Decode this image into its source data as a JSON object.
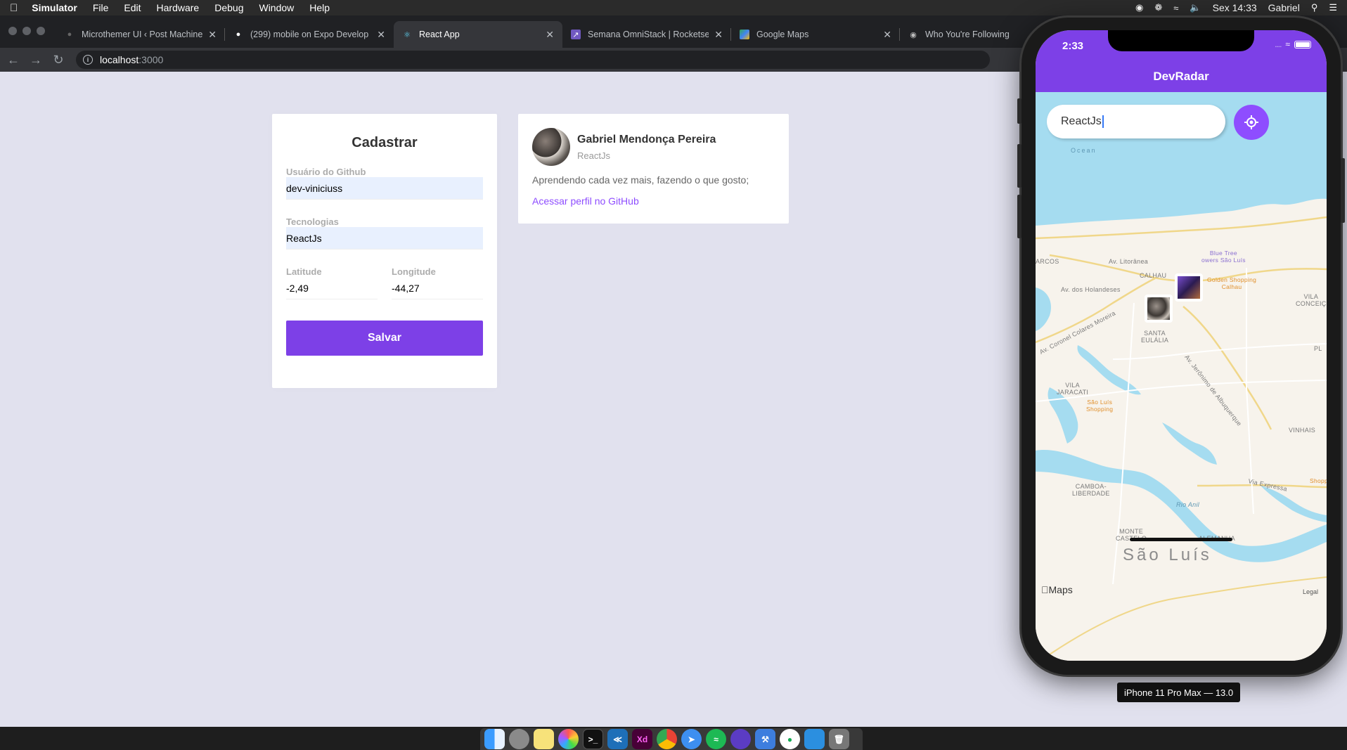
{
  "menubar": {
    "app": "Simulator",
    "items": [
      "File",
      "Edit",
      "Hardware",
      "Debug",
      "Window",
      "Help"
    ],
    "clock": "Sex 14:33",
    "user": "Gabriel"
  },
  "browser": {
    "tabs": [
      {
        "title": "Microthemer UI ‹ Post Machine",
        "icon": "wordpress-icon"
      },
      {
        "title": "(299) mobile on Expo Develop",
        "icon": "expo-icon"
      },
      {
        "title": "React App",
        "icon": "react-icon"
      },
      {
        "title": "Semana OmniStack | Rocketse",
        "icon": "rocketseat-icon"
      },
      {
        "title": "Google Maps",
        "icon": "google-maps-icon"
      },
      {
        "title": "Who You're Following",
        "icon": "github-icon"
      }
    ],
    "url_host": "localhost",
    "url_port": ":3000"
  },
  "form": {
    "title": "Cadastrar",
    "github_label": "Usuário do Github",
    "github_value": "dev-viniciuss",
    "techs_label": "Tecnologias",
    "techs_value": "ReactJs",
    "lat_label": "Latitude",
    "lat_value": "-2,49",
    "lng_label": "Longitude",
    "lng_value": "-44,27",
    "save_label": "Salvar"
  },
  "dev": {
    "name": "Gabriel Mendonça Pereira",
    "techs": "ReactJs",
    "bio": "Aprendendo cada vez mais, fazendo o que gosto;",
    "link": "Acessar perfil no GitHub"
  },
  "phone": {
    "time": "2:33",
    "app_title": "DevRadar",
    "search_value": "ReactJs",
    "device_label": "iPhone 11 Pro Max — 13.0",
    "map_labels": {
      "ocean": "Ocean",
      "arcos": "ARCOS",
      "av_litoranea": "Av. Litorânea",
      "calhau": "CALHAU",
      "av_holandeses": "Av. dos Holandeses",
      "blue_tree": "Blue Tree\nowers São Luís",
      "golden": "Golden Shopping\nCalhau",
      "vila_conceicao": "VILA\nCONCEIÇ",
      "santa_eulalia": "SANTA\nEULÁLIA",
      "coronel": "Av. Coronel Colares Moreira",
      "jeronimo": "Av. Jerônimo de Albuquerque",
      "vila_jaracati": "VILA\nJARACATI",
      "sao_luis_shopping": "São Luís\nShopping",
      "vinhais": "VINHAIS",
      "camboa": "CAMBOA-\nLIBERDADE",
      "via_expressa": "Via Expressa",
      "rio_anil": "Rio Anil",
      "monte_castelo": "MONTE\nCASTELO",
      "alemanha": "ALEMANHA",
      "city": "São Luís",
      "maps": "Maps",
      "legal": "Legal",
      "shopp": "Shopp",
      "pl": "PL"
    }
  },
  "colors": {
    "primary": "#7d40e7",
    "link": "#8e4dff",
    "page_bg": "#e1e1ee",
    "water": "#a5dcf0"
  }
}
